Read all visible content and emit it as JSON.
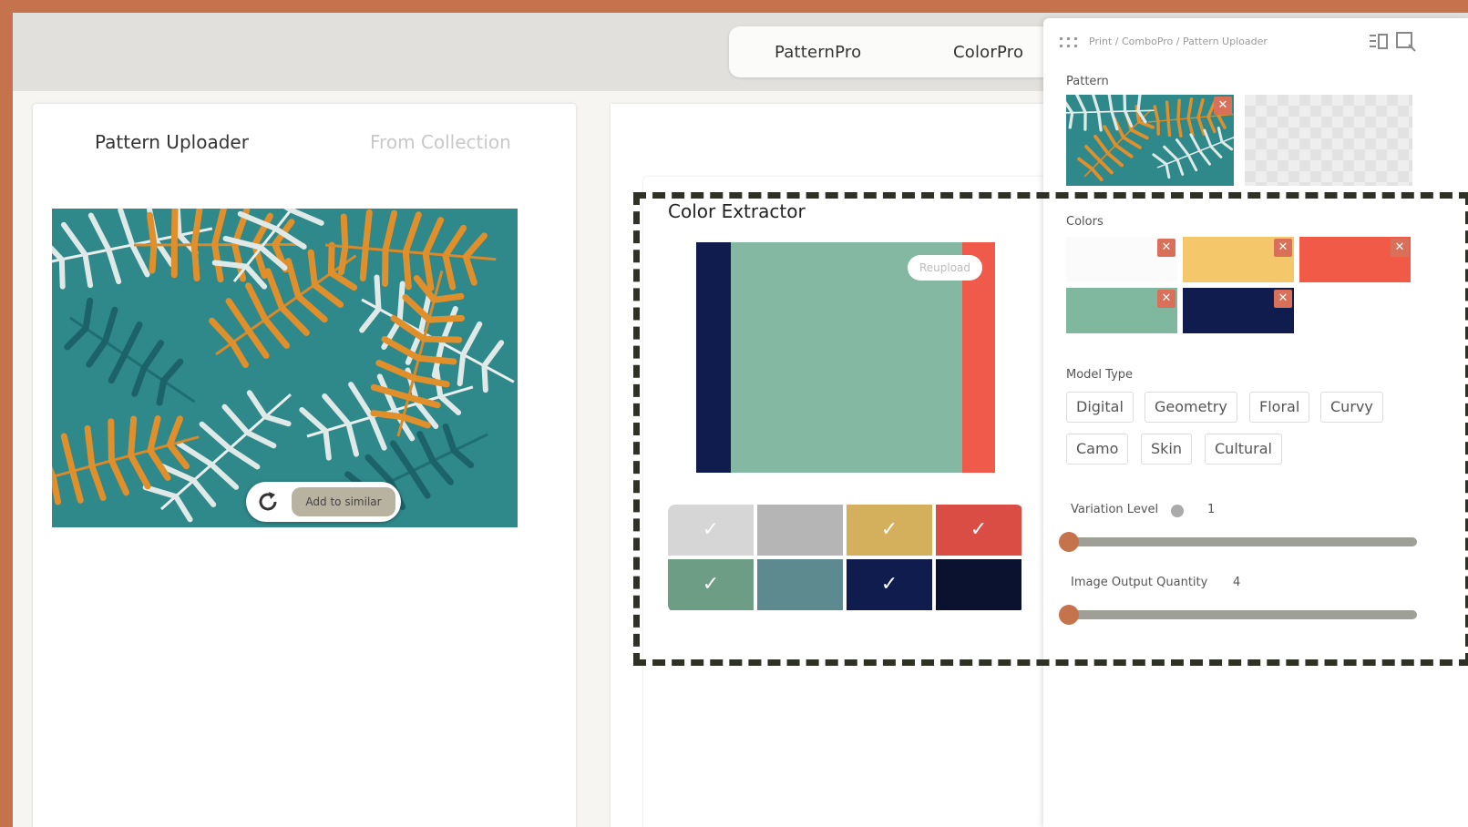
{
  "top_tabs": [
    "PatternPro",
    "ColorPro"
  ],
  "left_card": {
    "tab_uploader": "Pattern Uploader",
    "tab_collection": "From Collection",
    "overlay": {
      "button": "Add to similar"
    }
  },
  "extractor": {
    "title": "Color Extractor",
    "reupload": "Reupload",
    "swatch_colors": {
      "navy": "#0f1c4d",
      "sage": "#84b8a2",
      "red": "#ef5a4a"
    },
    "grid": [
      {
        "color": "#d6d6d6",
        "check": "✓"
      },
      {
        "color": "#b5b5b5",
        "check": ""
      },
      {
        "color": "#d4af5c",
        "check": "✓"
      },
      {
        "color": "#d94d45",
        "check": "✓"
      },
      {
        "color": "#6d9e85",
        "check": "✓"
      },
      {
        "color": "#5d8a8f",
        "check": ""
      },
      {
        "color": "#0f1c4d",
        "check": "✓"
      },
      {
        "color": "#0a1230",
        "check": ""
      }
    ]
  },
  "panel": {
    "breadcrumb": "Print / ComboPro / Pattern Uploader",
    "pattern_label": "Pattern",
    "colors_label": "Colors",
    "colors": [
      "#fbfbfb",
      "#f5c76b",
      "#f25a48",
      "#7fb89e",
      "#0f1c4d"
    ],
    "model_type_label": "Model Type",
    "model_types": [
      "Digital",
      "Geometry",
      "Floral",
      "Curvy",
      "Camo",
      "Skin",
      "Cultural"
    ],
    "variation_label": "Variation Level",
    "variation_value": "1",
    "output_label": "Image Output Quantity",
    "output_value": "4",
    "close_glyph": "✕"
  }
}
